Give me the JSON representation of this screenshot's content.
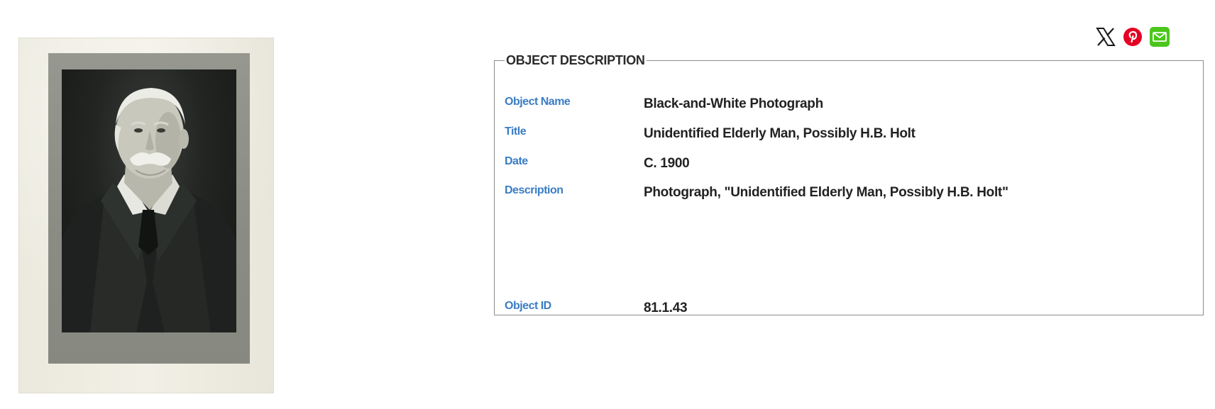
{
  "social": {
    "icons": [
      "x-icon",
      "pinterest-icon",
      "email-icon"
    ],
    "colors": {
      "pinterest": "#e60023",
      "email": "#4cc61c",
      "x": "#1a1a1a"
    }
  },
  "photo": {
    "alt": "Unidentified Elderly Man, Possibly H.B. Holt"
  },
  "section": {
    "legend": "OBJECT DESCRIPTION",
    "accent_color": "#3a7dc4"
  },
  "fields": {
    "object_name": {
      "label": "Object Name",
      "value": "Black-and-White Photograph"
    },
    "title": {
      "label": "Title",
      "value": "Unidentified Elderly Man, Possibly H.B. Holt"
    },
    "date": {
      "label": "Date",
      "value": "C. 1900"
    },
    "description": {
      "label": "Description",
      "value": "Photograph, \"Unidentified Elderly Man, Possibly H.B. Holt\""
    },
    "object_id": {
      "label": "Object ID",
      "value": "81.1.43"
    }
  }
}
